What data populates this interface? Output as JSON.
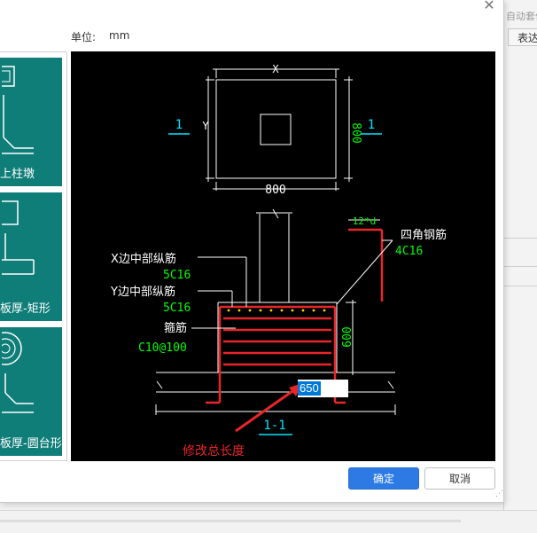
{
  "background": {
    "right_title": "自动套价",
    "right_tab": "表达"
  },
  "dialog": {
    "unit_label": "单位:",
    "unit_value": "mm",
    "close_glyph": "✕",
    "ok_label": "确定",
    "cancel_label": "取消"
  },
  "thumbnails": [
    {
      "caption": "上柱墩"
    },
    {
      "caption": "板厚-矩形"
    },
    {
      "caption": "板厚-圆台形"
    }
  ],
  "drawing": {
    "top_dim_x": "X",
    "side_dim_y": "Y",
    "dim_800_bottom": "800",
    "dim_800_right": "800",
    "section_mark_left": "1",
    "section_mark_right": "1",
    "bar_label": "12*d",
    "corner_bar_label": "四角钢筋",
    "corner_bar_spec": "4C16",
    "x_mid_bar_label": "X边中部纵筋",
    "x_mid_bar_spec": "5C16",
    "y_mid_bar_label": "Y边中部纵筋",
    "y_mid_bar_spec": "5C16",
    "stirrup_label": "箍筋",
    "stirrup_spec": "C10@100",
    "height_600": "600",
    "section_title": "1-1",
    "annotation": "修改总长度",
    "edit_value": "650"
  },
  "colors": {
    "canvas_bg": "#000000",
    "white_line": "#ffffff",
    "green_text": "#00ff00",
    "cyan_text": "#00e5ff",
    "red": "#e8262a",
    "teal_thumb": "#0f7d78",
    "primary_button": "#2d7ae5"
  }
}
